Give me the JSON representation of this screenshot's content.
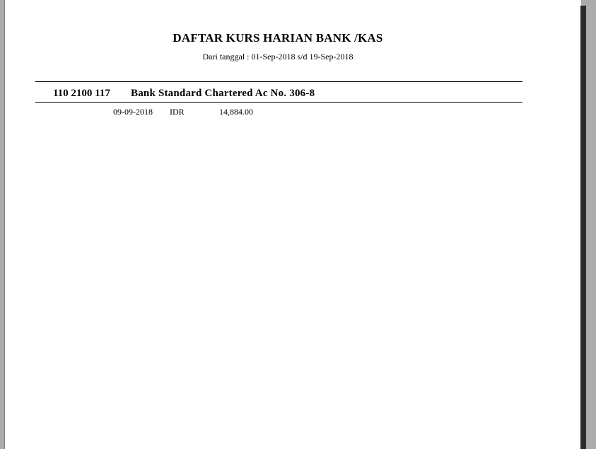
{
  "report": {
    "title": "DAFTAR KURS HARIAN BANK /KAS",
    "subtitle": "Dari tanggal : 01-Sep-2018 s/d 19-Sep-2018"
  },
  "account": {
    "code": "110 2100 117",
    "name": "Bank Standard Chartered Ac No. 306-8"
  },
  "rates": [
    {
      "date": "09-09-2018",
      "currency": "IDR",
      "value": "14,884.00"
    }
  ]
}
